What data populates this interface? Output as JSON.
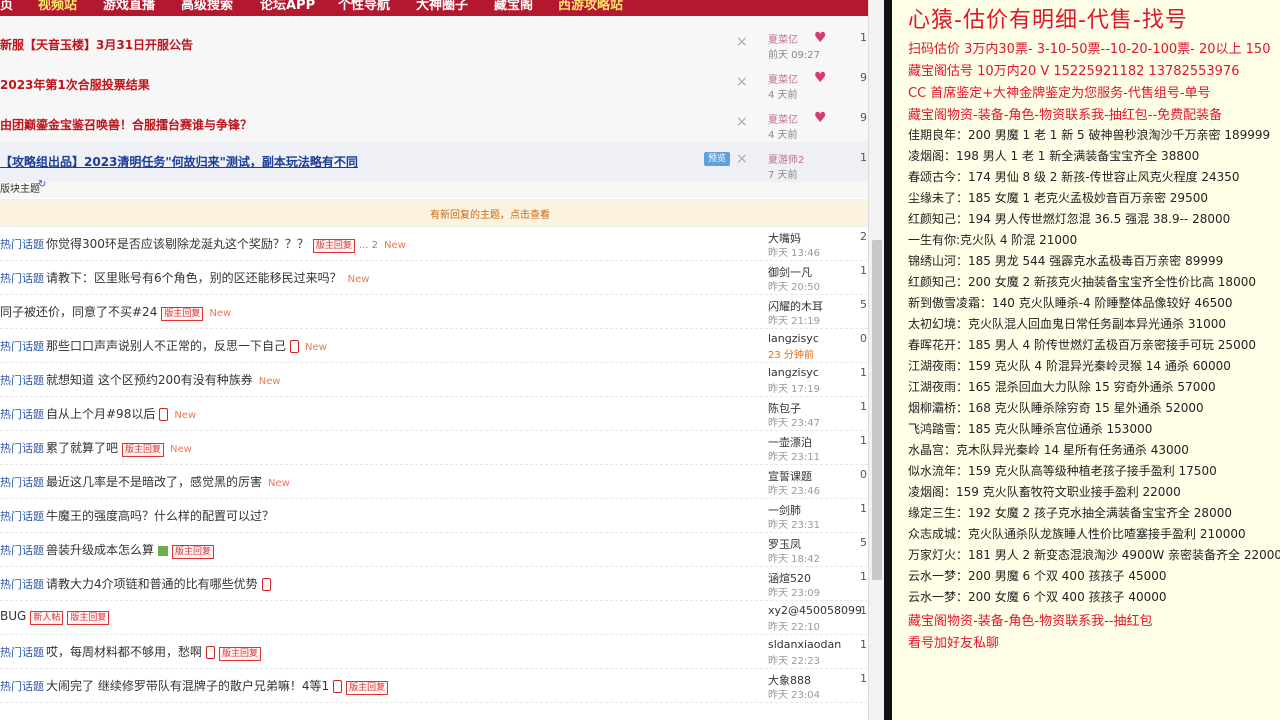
{
  "nav": [
    "视频站",
    "游戏直播",
    "高级搜索",
    "论坛APP",
    "个性导航",
    "大神圈子",
    "藏宝阁",
    "西游攻略站"
  ],
  "sticky": [
    {
      "title": "新服【天音玉楼】3月31日开服公告",
      "author": "夏菜亿",
      "date": "前天 09:27",
      "count": "1"
    },
    {
      "title": "2023年第1次合服投票结果",
      "author": "夏菜亿",
      "date": "4 天前",
      "count": "9"
    },
    {
      "title": "由团巅鎏金宝鉴召唤兽！合服擂台赛谁与争锋？",
      "author": "夏菜亿",
      "date": "4 天前",
      "count": "9"
    },
    {
      "title": "【攻略组出品】2023清明任务\"何故归来\"测试，副本玩法略有不同",
      "author": "夏游师2",
      "date": "7 天前",
      "count": "1",
      "preview": "预览"
    }
  ],
  "block_header": "版块主题",
  "separator": "有新回复的主题，点击查看",
  "threads": [
    {
      "cat": "热门话题",
      "title": "你觉得300环是否应该剔除龙涎丸这个奖励？？？",
      "tag": "版主回复",
      "extra": "... 2",
      "new": "New",
      "author": "大嘴妈",
      "date": "昨天 13:46",
      "count": "2"
    },
    {
      "cat": "热门话题",
      "title": "请教下：区里账号有6个角色，别的区还能移民过来吗？",
      "new": "New",
      "author": "御剑一凡",
      "date": "昨天 20:50",
      "count": "1"
    },
    {
      "cat": "",
      "title": "同子被还价，同意了不买#24",
      "tag": "版主回复",
      "new": "New",
      "author": "闪耀的木耳",
      "date": "昨天 21:19",
      "count": "5"
    },
    {
      "cat": "热门话题",
      "title": "那些口口声声说别人不正常的，反思一下自己",
      "phone": true,
      "new": "New",
      "author": "langzisyc",
      "date": "23 分钟前",
      "count": "0"
    },
    {
      "cat": "热门话题",
      "title": "就想知道 这个区预约200有没有种族券",
      "new": "New",
      "author": "langzisyc",
      "date": "昨天 17:19",
      "count": "1"
    },
    {
      "cat": "热门话题",
      "title": "自从上个月#98以后",
      "phone": true,
      "new": "New",
      "author": "陈包子",
      "date": "昨天 23:47",
      "count": "1"
    },
    {
      "cat": "热门话题",
      "title": "累了就算了吧",
      "tag": "版主回复",
      "new": "New",
      "author": "一壶漂泊",
      "date": "昨天 23:11",
      "count": "1"
    },
    {
      "cat": "热门话题",
      "title": "最近这几率是不是暗改了，感觉黑的厉害",
      "new": "New",
      "author": "宣誓课题",
      "date": "昨天 23:46",
      "count": "0"
    },
    {
      "cat": "热门话题",
      "title": "牛魔王的强度高吗？什么样的配置可以过？",
      "author": "一剑肺",
      "date": "昨天 23:31",
      "count": "1"
    },
    {
      "cat": "热门话题",
      "title": "兽装升级成本怎么算",
      "img": true,
      "tag": "版主回复",
      "author": "罗玉凤",
      "date": "昨天 18:42",
      "count": "5"
    },
    {
      "cat": "热门话题",
      "title": "请教大力4介项链和普通的比有哪些优势",
      "phone": true,
      "author": "涵煊520",
      "date": "昨天 23:09",
      "count": "1"
    },
    {
      "cat": "",
      "title": "BUG",
      "tag2": "新人帖",
      "tag": "版主回复",
      "author": "xy2@450058099",
      "date": "昨天 22:10",
      "count": "1"
    },
    {
      "cat": "热门话题",
      "title": "哎，每周材料都不够用，愁啊",
      "phone": true,
      "tag": "版主回复",
      "author": "sldanxiaodan",
      "date": "昨天 22:23",
      "count": "1"
    },
    {
      "cat": "热门话题",
      "title": "大闹完了 继续修罗带队有混牌子的散户兄弟嘛！4等1",
      "phone": true,
      "tag": "版主回复",
      "author": "大象888",
      "date": "昨天 23:04",
      "count": "1"
    }
  ],
  "right": {
    "title": "心猿-估价有明细-代售-找号",
    "lines": [
      {
        "text": "扫码估价 3万内30票- 3-10-50票--10-20-100票- 20以上 150",
        "red": true
      },
      {
        "text": "藏宝阁估号 10万内20 V 15225921182   13782553976",
        "red": true
      },
      {
        "text": "CC 首席鉴定+大神金牌鉴定为您服务-代售组号-单号",
        "red": true
      },
      {
        "text": "藏宝阁物资-装备-角色-物资联系我-抽红包--免费配装备",
        "red": true
      },
      {
        "text": "佳期良年：200 男魔 1 老 1 新 5 破神兽秒浪淘沙千万亲密 189999"
      },
      {
        "text": "凌烟阁：198 男人 1 老 1 新全满装备宝宝齐全 38800"
      },
      {
        "text": "春颂古今：174 男仙 8 级 2 新孩-传世容止风克火程度 24350"
      },
      {
        "text": "尘缘未了：185 女魔 1 老克火孟极妙音百万亲密 29500"
      },
      {
        "text": "红颜知己：194 男人传世燃灯忽混 36.5 强混 38.9-- 28000"
      },
      {
        "text": "一生有你:克火队 4 阶混 21000"
      },
      {
        "text": "锦绣山河：185 男龙 544 强霹克水孟极毒百万亲密 89999"
      },
      {
        "text": "红颜知己：200 女魔 2 新孩克火抽装备宝宝齐全性价比高 18000"
      },
      {
        "text": "新到傲雪凌霜：140 克火队睡杀-4 阶睡整体品像较好 46500"
      },
      {
        "text": "太初幻境：克火队混人回血鬼日常任务副本异光通杀 31000"
      },
      {
        "text": "春晖花开：185 男人 4 阶传世燃灯孟极百万亲密接手可玩 25000"
      },
      {
        "text": "江湖夜雨：159 克火队 4 阶混异光秦岭灵猴 14 通杀 60000"
      },
      {
        "text": "江湖夜雨：165 混杀回血大力队除 15 穷奇外通杀 57000"
      },
      {
        "text": "烟柳灞桥：168 克火队睡杀除穷奇 15 星外通杀 52000"
      },
      {
        "text": "飞鸿踏雪：185 克火队睡杀宫位通杀 153000"
      },
      {
        "text": "水晶宫：克木队异光秦岭 14 星所有任务通杀 43000"
      },
      {
        "text": "似水流年：159 克火队高等级种植老孩子接手盈利 17500"
      },
      {
        "text": "凌烟阁：159 克火队畜牧符文职业接手盈利 22000"
      },
      {
        "text": "缘定三生：192 女魔 2 孩子克水抽全满装备宝宝齐全 28000"
      },
      {
        "text": "众志成城：克火队通杀队龙族睡人性价比喳塞接手盈利 210000"
      },
      {
        "text": "万家灯火：181 男人 2 新变态混浪淘沙 4900W 亲密装备齐全 220000"
      },
      {
        "text": "云水一梦：200 男魔 6 个双 400 孩孩子 45000"
      },
      {
        "text": "云水一梦：200 女魔 6 个双 400 孩孩子 40000"
      },
      {
        "text": "藏宝阁物资-装备-角色-物资联系我--抽红包",
        "red": true
      },
      {
        "text": "看号加好友私聊",
        "red": true
      }
    ]
  }
}
